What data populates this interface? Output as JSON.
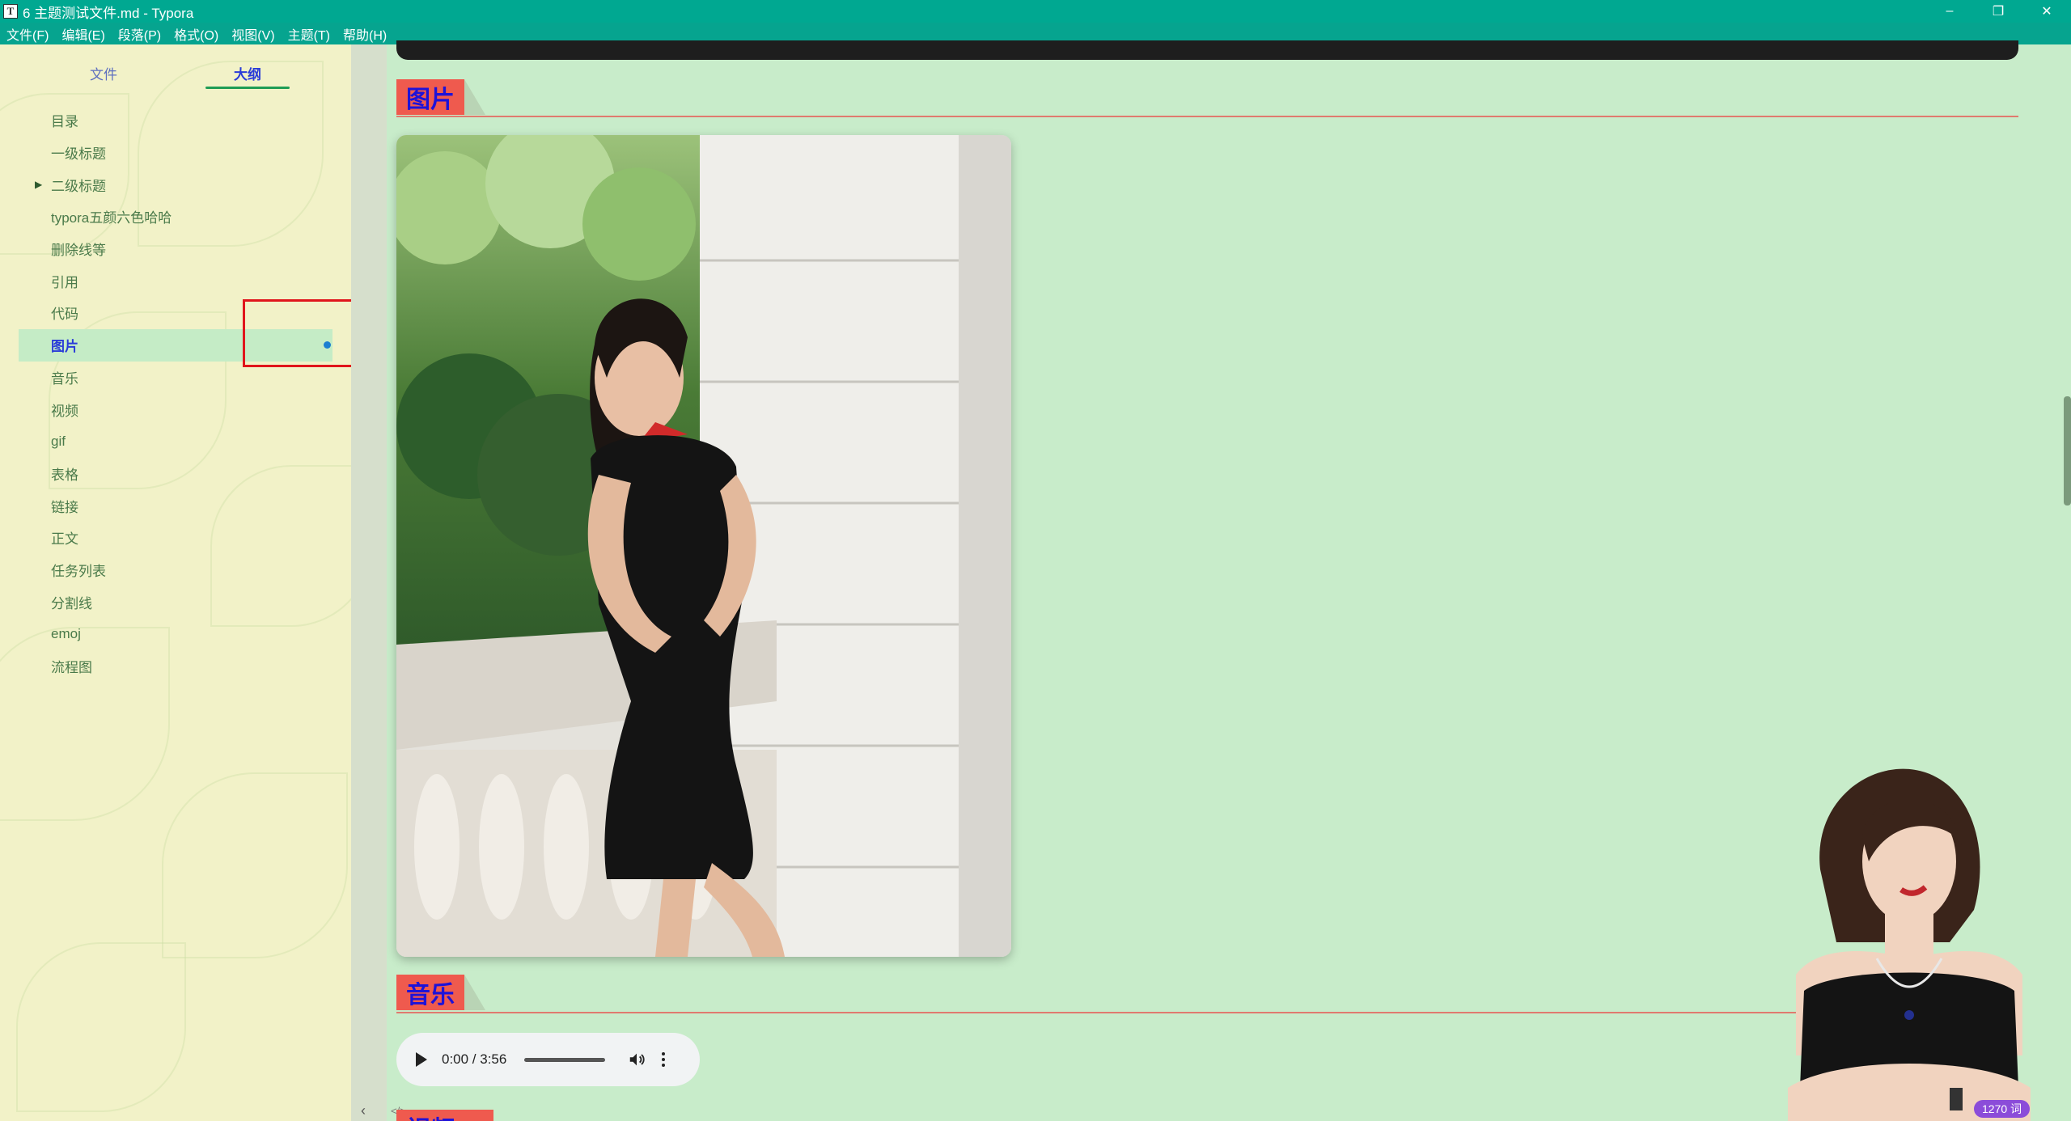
{
  "window": {
    "title": "6 主题测试文件.md - Typora",
    "app_icon_letter": "T",
    "minimize_icon": "–",
    "restore_icon": "❐",
    "close_icon": "✕"
  },
  "menu": [
    "文件(F)",
    "编辑(E)",
    "段落(P)",
    "格式(O)",
    "视图(V)",
    "主题(T)",
    "帮助(H)"
  ],
  "sidebar": {
    "tabs": [
      {
        "label": "文件",
        "active": false
      },
      {
        "label": "大纲",
        "active": true
      }
    ],
    "outline": [
      {
        "label": "目录"
      },
      {
        "label": "一级标题"
      },
      {
        "label": "二级标题",
        "collapsible": true
      },
      {
        "label": "typora五颜六色哈哈"
      },
      {
        "label": "删除线等"
      },
      {
        "label": "引用"
      },
      {
        "label": "代码"
      },
      {
        "label": "图片",
        "active": true
      },
      {
        "label": "音乐"
      },
      {
        "label": "视频"
      },
      {
        "label": "gif"
      },
      {
        "label": "表格"
      },
      {
        "label": "链接"
      },
      {
        "label": "正文"
      },
      {
        "label": "任务列表"
      },
      {
        "label": "分割线"
      },
      {
        "label": "emoj"
      },
      {
        "label": "流程图"
      }
    ],
    "collapse_icon": "‹",
    "source_toggle_icon": "</>"
  },
  "editor": {
    "headings": {
      "image": "图片",
      "music": "音乐",
      "video": "视频"
    },
    "audio": {
      "time": "0:00 / 3:56"
    }
  },
  "status": {
    "word_count": "1270 词"
  },
  "colors": {
    "title_bar": "#00a891",
    "content_bg": "#c8ecca",
    "heading_bg": "#ef5a4e",
    "heading_text": "#1e12d8",
    "highlight": "#e0161c",
    "word_count_bg": "#8b4cd9"
  }
}
